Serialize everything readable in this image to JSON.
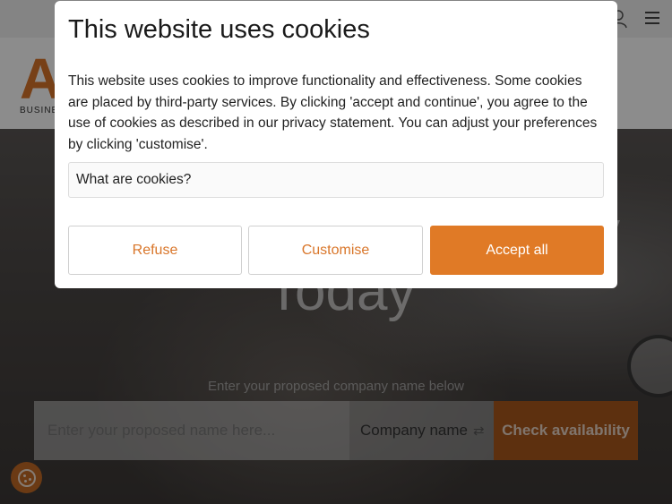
{
  "page": {
    "logo_letter": "A",
    "logo_sub": "BUSINE",
    "hero_heading": "Today",
    "hero_heading_partial": "y",
    "caption": "Enter your proposed company name below",
    "search_placeholder": "Enter your proposed name here...",
    "company_type": "Company name",
    "check_button": "Check availability"
  },
  "cookie_modal": {
    "title": "This website uses cookies",
    "body": "This website uses cookies to improve functionality and effectiveness. Some cookies are placed by third-party services. By clicking 'accept and continue', you agree to the use of cookies as described in our privacy statement. You can adjust your preferences by clicking 'customise'.",
    "what_are_cookies": "What are cookies?",
    "refuse_label": "Refuse",
    "customise_label": "Customise",
    "accept_label": "Accept all"
  },
  "colors": {
    "accent": "#e07a26",
    "accent_dark": "#a9581d"
  },
  "icons": {
    "user": "user-icon",
    "menu": "hamburger-menu-icon",
    "swap": "swap-icon",
    "cookie": "cookie-icon"
  }
}
